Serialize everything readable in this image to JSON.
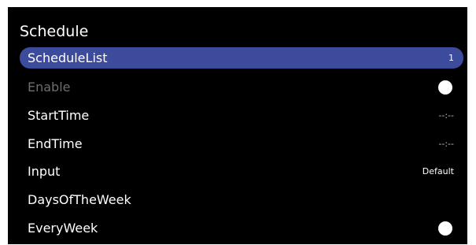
{
  "menu": {
    "title": "Schedule",
    "items": [
      {
        "label": "ScheduleList",
        "value": "1"
      },
      {
        "label": "Enable",
        "toggle_icon": "toggle-knob-icon"
      },
      {
        "label": "StartTime",
        "value": "--:--"
      },
      {
        "label": "EndTime",
        "value": "--:--"
      },
      {
        "label": "Input",
        "value": "Default"
      },
      {
        "label": "DaysOfTheWeek",
        "value": ""
      },
      {
        "label": "EveryWeek",
        "toggle_icon": "toggle-knob-icon"
      }
    ]
  },
  "colors": {
    "background": "#000000",
    "highlight": "#3d4b9c",
    "disabled_text": "#6e6e6e"
  }
}
